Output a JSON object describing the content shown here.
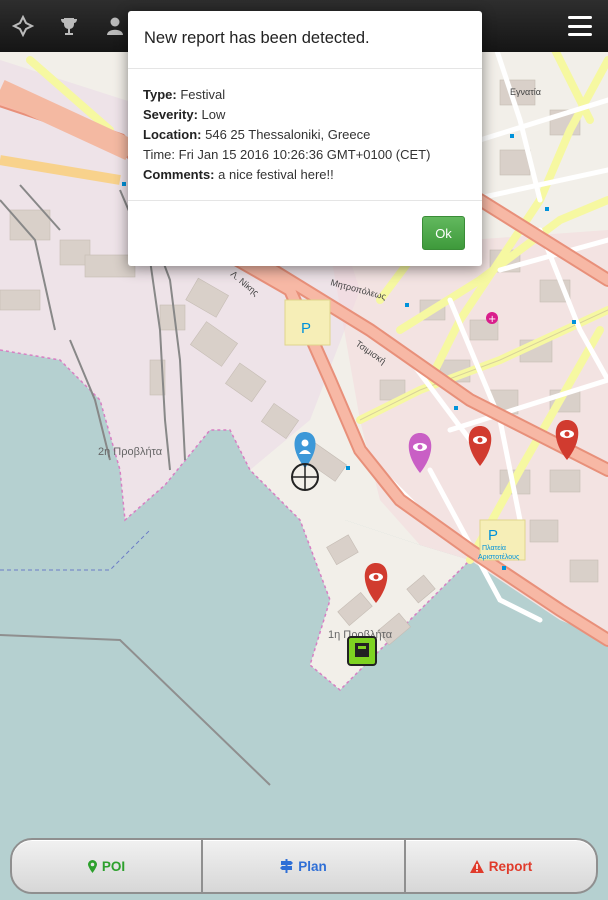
{
  "topbar": {
    "icons": [
      "compass-icon",
      "trophy-icon",
      "user-icon"
    ],
    "menu_icon": "hamburger-menu-icon"
  },
  "dialog": {
    "title": "New report has been detected.",
    "type_label": "Type:",
    "type_value": "Festival",
    "severity_label": "Severity:",
    "severity_value": "Low",
    "location_label": "Location:",
    "location_value": "546 25 Thessaloniki, Greece",
    "time_text": "Time: Fri Jan 15 2016 10:26:36 GMT+0100 (CET)",
    "comments_label": "Comments:",
    "comments_value": "a nice festival here!!",
    "ok_label": "Ok"
  },
  "map": {
    "labels": {
      "pier": "2η Προβλήτα",
      "pier_lower": "1η Προβλήτα",
      "parking_1": "P",
      "parking_2": "P",
      "parking_note_1": "Πλατεία",
      "parking_note_2": "Αριστοτέλους",
      "street_a": "Λ. Νίκης",
      "street_b": "Τσιμισκή",
      "street_c": "Μητροπόλεως",
      "street_d": "Εγνατία"
    },
    "colors": {
      "sea": "#b5d0d0",
      "land": "#f2efe9",
      "primary_road": "#f1a58c",
      "secondary_road": "#f6f8a1",
      "report_marker": "#d13b2f",
      "festival_marker": "#c95fc5",
      "user_marker": "#3c98d8"
    }
  },
  "bottom_bar": {
    "poi_label": "POI",
    "plan_label": "Plan",
    "report_label": "Report",
    "poi_color": "#2ca02c",
    "plan_color": "#2f6fd6",
    "report_color": "#e03b2b"
  }
}
